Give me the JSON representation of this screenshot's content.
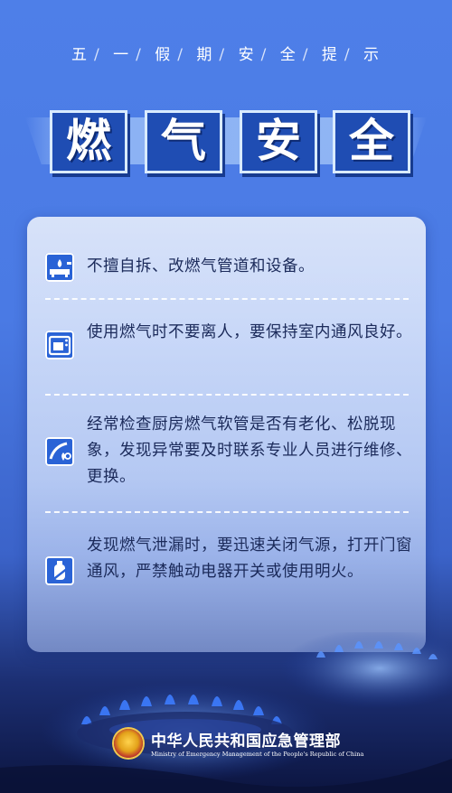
{
  "subtitle": [
    "五",
    "一",
    "假",
    "期",
    "安",
    "全",
    "提",
    "示"
  ],
  "title": [
    "燃",
    "气",
    "安",
    "全"
  ],
  "tips": [
    {
      "icon": "gas-stove-icon",
      "text": "不擅自拆、改燃气管道和设备。"
    },
    {
      "icon": "oven-icon",
      "text": "使用燃气时不要离人，要保持室内通风良好。"
    },
    {
      "icon": "gas-hose-icon",
      "text": "经常检查厨房燃气软管是否有老化、松脱现象，发现异常要及时联系专业人员进行维修、更换。"
    },
    {
      "icon": "gas-cylinder-icon",
      "text": "发现燃气泄漏时，要迅速关闭气源，打开门窗通风，严禁触动电器开关或使用明火。"
    }
  ],
  "ministry": {
    "name": "中华人民共和国应急管理部",
    "name_en": "Ministry of Emergency Management of the People's Republic of China"
  },
  "colors": {
    "background": "#4e7fe8",
    "title_box": "#1f4db3",
    "text": "#1b2a5a"
  }
}
